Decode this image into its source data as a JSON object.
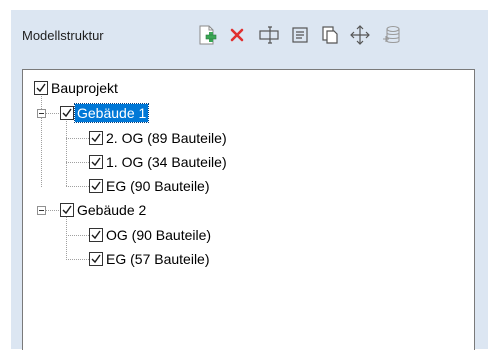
{
  "panel": {
    "title": "Modellstruktur",
    "toolbar": [
      {
        "name": "add-icon",
        "color": "#3aa655"
      },
      {
        "name": "delete-icon",
        "color": "#e03030"
      },
      {
        "name": "rename-icon",
        "color": "#555555"
      },
      {
        "name": "properties-icon",
        "color": "#555555"
      },
      {
        "name": "copy-icon",
        "color": "#555555"
      },
      {
        "name": "move-icon",
        "color": "#555555"
      },
      {
        "name": "database-icon",
        "color": "#9a9a9a"
      }
    ]
  },
  "tree": {
    "root": {
      "label": "Bauprojekt",
      "checked": true
    },
    "buildings": [
      {
        "label": "Gebäude 1",
        "checked": true,
        "selected": true,
        "expanded": true,
        "floors": [
          {
            "label": "2. OG (89 Bauteile)",
            "checked": true
          },
          {
            "label": "1. OG (34 Bauteile)",
            "checked": true
          },
          {
            "label": "EG (90 Bauteile)",
            "checked": true
          }
        ]
      },
      {
        "label": "Gebäude 2",
        "checked": true,
        "selected": false,
        "expanded": true,
        "floors": [
          {
            "label": "OG (90 Bauteile)",
            "checked": true
          },
          {
            "label": "EG (57 Bauteile)",
            "checked": true
          }
        ]
      }
    ]
  },
  "colors": {
    "selection": "#0078d7",
    "panel_background": "#dce6f2"
  }
}
